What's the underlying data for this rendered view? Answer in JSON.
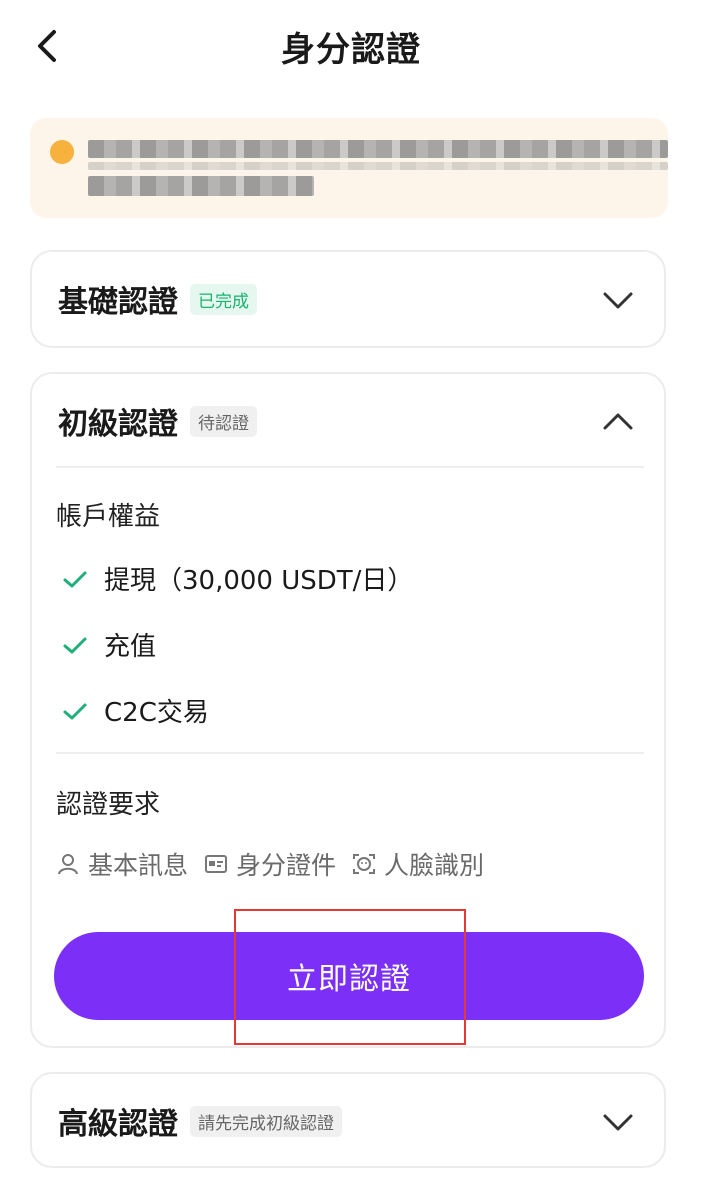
{
  "header": {
    "title": "身分認證",
    "back_icon": "chevron-left-icon"
  },
  "notice": {
    "icon": "warning-dot-icon",
    "text_redacted": true
  },
  "basic": {
    "title": "基礎認證",
    "badge": "已完成",
    "badge_color": "#19b46e",
    "chevron": "chevron-down-icon"
  },
  "primary": {
    "title": "初級認證",
    "badge": "待認證",
    "chevron": "chevron-up-icon",
    "benefits_label": "帳戶權益",
    "benefits": [
      "提現（30,000 USDT/日）",
      "充值",
      "C2C交易"
    ],
    "requirements_label": "認證要求",
    "requirements": [
      {
        "icon": "user-icon",
        "label": "基本訊息"
      },
      {
        "icon": "id-card-icon",
        "label": "身分證件"
      },
      {
        "icon": "face-scan-icon",
        "label": "人臉識別"
      }
    ],
    "cta_label": "立即認證",
    "cta_color": "#7b2ff7"
  },
  "advanced": {
    "title": "高級認證",
    "badge": "請先完成初級認證",
    "chevron": "chevron-down-icon"
  },
  "colors": {
    "accent": "#7b2ff7",
    "success": "#19b46e",
    "notice_bg": "#fdf5e9",
    "highlight": "#e53935"
  }
}
